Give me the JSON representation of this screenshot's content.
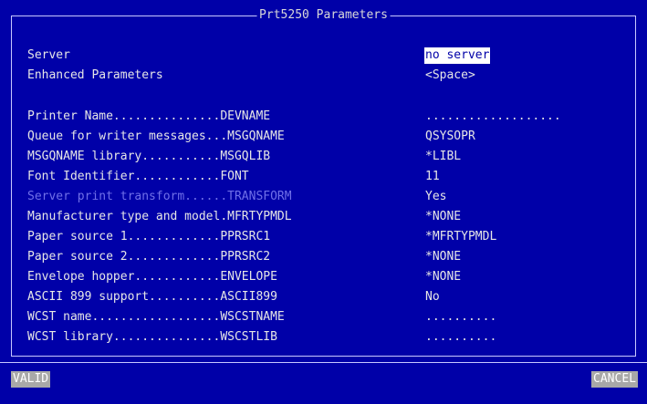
{
  "window": {
    "title": "Prt5250 Parameters"
  },
  "header_rows": [
    {
      "label": "Server",
      "value": "no server"
    },
    {
      "label": "Enhanced Parameters",
      "value": "<Space>"
    }
  ],
  "param_rows": [
    {
      "label": "Printer Name...............DEVNAME",
      "value": "..................."
    },
    {
      "label": "Queue for writer messages...MSGQNAME",
      "value": "QSYSOPR"
    },
    {
      "label": "MSGQNAME library...........MSGQLIB",
      "value": "*LIBL"
    },
    {
      "label": "Font Identifier............FONT",
      "value": "11"
    },
    {
      "label": "Server print transform......TRANSFORM",
      "value": "Yes"
    },
    {
      "label": "Manufacturer type and model.MFRTYPMDL",
      "value": "*NONE"
    },
    {
      "label": "Paper source 1.............PPRSRC1",
      "value": "*MFRTYPMDL"
    },
    {
      "label": "Paper source 2.............PPRSRC2",
      "value": "*NONE"
    },
    {
      "label": "Envelope hopper............ENVELOPE",
      "value": "*NONE"
    },
    {
      "label": "ASCII 899 support..........ASCII899",
      "value": "No"
    },
    {
      "label": "WCST name..................WSCSTNAME",
      "value": ".........."
    },
    {
      "label": "WCST library...............WSCSTLIB",
      "value": ".........."
    }
  ],
  "buttons": {
    "valid": "VALID",
    "cancel": "CANCEL"
  },
  "colors": {
    "background": "#0000a8",
    "text": "#e6e6e6",
    "disabled": "#7070e8",
    "button": "#a8a8a8",
    "selection_bg": "#ffffff"
  }
}
